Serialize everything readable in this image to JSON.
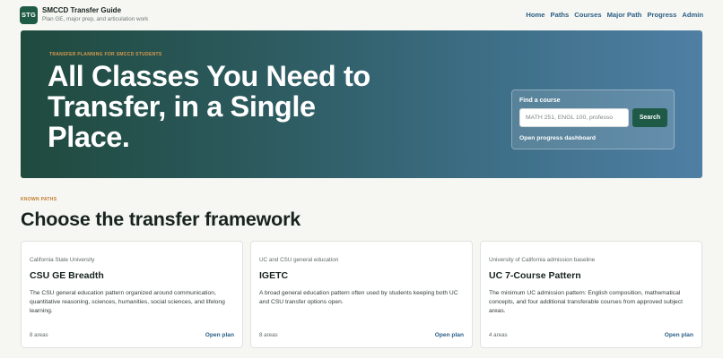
{
  "brand": {
    "logo_text": "STG",
    "title": "SMCCD Transfer Guide",
    "subtitle": "Plan GE, major prep, and articulation work"
  },
  "nav": {
    "items": [
      {
        "label": "Home"
      },
      {
        "label": "Paths"
      },
      {
        "label": "Courses"
      },
      {
        "label": "Major Path"
      },
      {
        "label": "Progress"
      },
      {
        "label": "Admin"
      }
    ]
  },
  "hero": {
    "eyebrow": "TRANSFER PLANNING FOR SMCCD STUDENTS",
    "title": "All Classes You Need to Transfer, in a Single Place.",
    "find": {
      "label": "Find a course",
      "placeholder": "MATH 251, ENGL 100, professo",
      "value": "",
      "button": "Search",
      "progress_link": "Open progress dashboard"
    }
  },
  "section": {
    "eyebrow": "KNOWN PATHS",
    "title": "Choose the transfer framework"
  },
  "cards": [
    {
      "kicker": "California State University",
      "title": "CSU GE Breadth",
      "description": "The CSU general education pattern organized around communication, quantitative reasoning, sciences, humanities, social sciences, and lifelong learning.",
      "count": "8 areas",
      "link": "Open plan"
    },
    {
      "kicker": "UC and CSU general education",
      "title": "IGETC",
      "description": "A broad general education pattern often used by students keeping both UC and CSU transfer options open.",
      "count": "8 areas",
      "link": "Open plan"
    },
    {
      "kicker": "University of California admission baseline",
      "title": "UC 7-Course Pattern",
      "description": "The minimum UC admission pattern: English composition, mathematical concepts, and four additional transferable courses from approved subject areas.",
      "count": "4 areas",
      "link": "Open plan"
    }
  ],
  "colors": {
    "brand_green": "#1f5a46",
    "link_blue": "#2a5f86",
    "eyebrow_orange": "#c07c2e",
    "hero_gradient_start": "#1f4a3e",
    "hero_gradient_end": "#4f7fa3"
  }
}
